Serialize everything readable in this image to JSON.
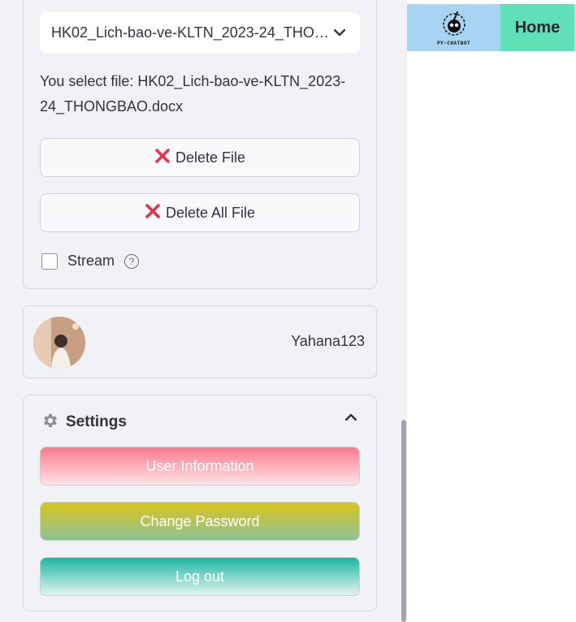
{
  "file_panel": {
    "selected_file": "HK02_Lich-bao-ve-KLTN_2023-24_THONGBAO.docx",
    "info_text": "You select file: HK02_Lich-bao-ve-KLTN_2023-24_THONGBAO.docx",
    "delete_file_label": "Delete File",
    "delete_all_label": "Delete All File",
    "stream_label": "Stream",
    "stream_checked": false
  },
  "user_card": {
    "username": "Yahana123"
  },
  "settings": {
    "title": "Settings",
    "user_info_label": "User Information",
    "change_password_label": "Change Password",
    "logout_label": "Log out"
  },
  "header": {
    "logo_text": "PY-CHATBOT",
    "nav_home": "Home"
  },
  "colors": {
    "sidebar_bg": "#f0f2f6",
    "delete_icon": "#e5334b",
    "user_info_gradient": [
      "#fb7a8e",
      "#fde3e6"
    ],
    "change_password_gradient": [
      "#d7c51d",
      "#8fc297"
    ],
    "logout_gradient": [
      "#1ab7a1",
      "#e6f4f1"
    ],
    "logo_bg": "#a9d3f2",
    "home_bg": "#5fe0b7"
  },
  "icons": {
    "delete": "x-icon",
    "help": "help-icon",
    "settings": "gear-icon",
    "collapse": "chevron-up-icon",
    "dropdown": "chevron-down-icon"
  }
}
